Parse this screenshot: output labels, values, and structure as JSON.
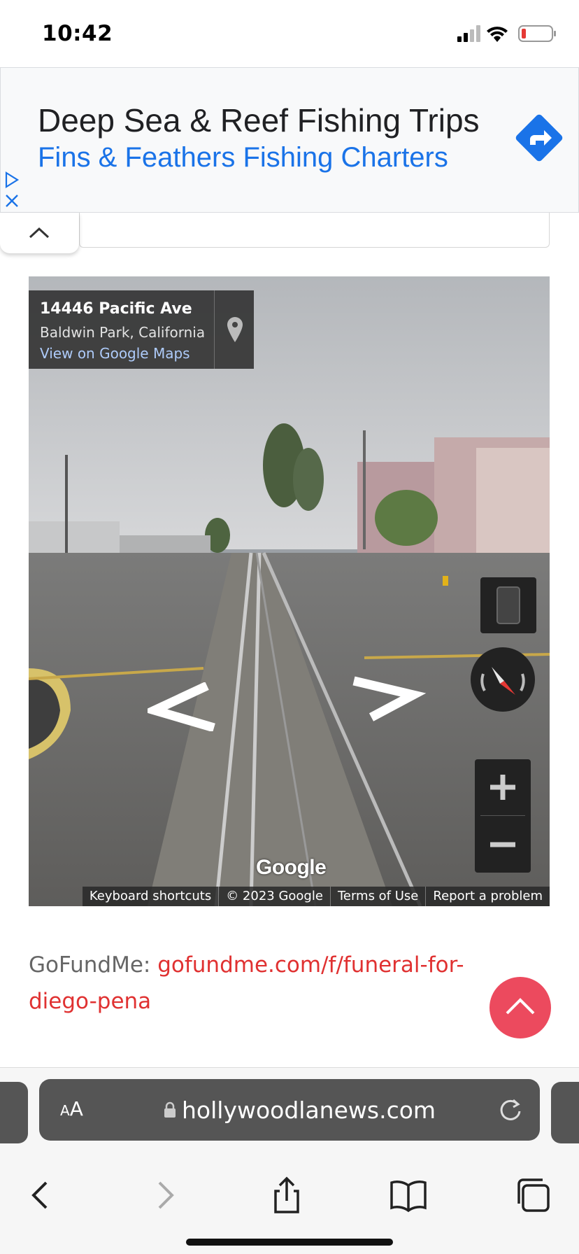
{
  "status_bar": {
    "time": "10:42",
    "icons": [
      "cellular-signal-icon",
      "wifi-icon",
      "battery-low-icon"
    ],
    "battery_color": "#e53935"
  },
  "ad": {
    "title": "Deep Sea & Reef Fishing Trips",
    "advertiser": "Fins & Feathers Fishing Charters",
    "icons": [
      "ad-choices-icon",
      "ad-close-icon",
      "directions-arrow-icon"
    ],
    "accent_color": "#1a73e8"
  },
  "street_view": {
    "address": "14446 Pacific Ave",
    "city": "Baldwin Park, California",
    "maps_link": "View on Google Maps",
    "logo": "Google",
    "footer": {
      "shortcuts": "Keyboard shortcuts",
      "copyright": "© 2023 Google",
      "terms": "Terms of Use",
      "report": "Report a problem"
    },
    "controls": [
      "fullscreen-icon",
      "compass-icon",
      "zoom-in-icon",
      "zoom-out-icon",
      "pan-left-arrow",
      "pan-right-arrow",
      "map-pin-icon"
    ]
  },
  "article": {
    "gofund_label": "GoFundMe: ",
    "gofund_link": "gofundme.com/f/funeral-for-diego-pena",
    "link_color": "#e03131"
  },
  "scroll_top": {
    "icon": "chevron-up-icon",
    "color": "#ec4a5e"
  },
  "safari": {
    "aa_small": "A",
    "aa_big": "A",
    "url": "hollywoodlanews.com",
    "toolbar_icons": [
      "back-icon",
      "forward-icon",
      "share-icon",
      "bookmarks-icon",
      "tabs-icon"
    ]
  }
}
